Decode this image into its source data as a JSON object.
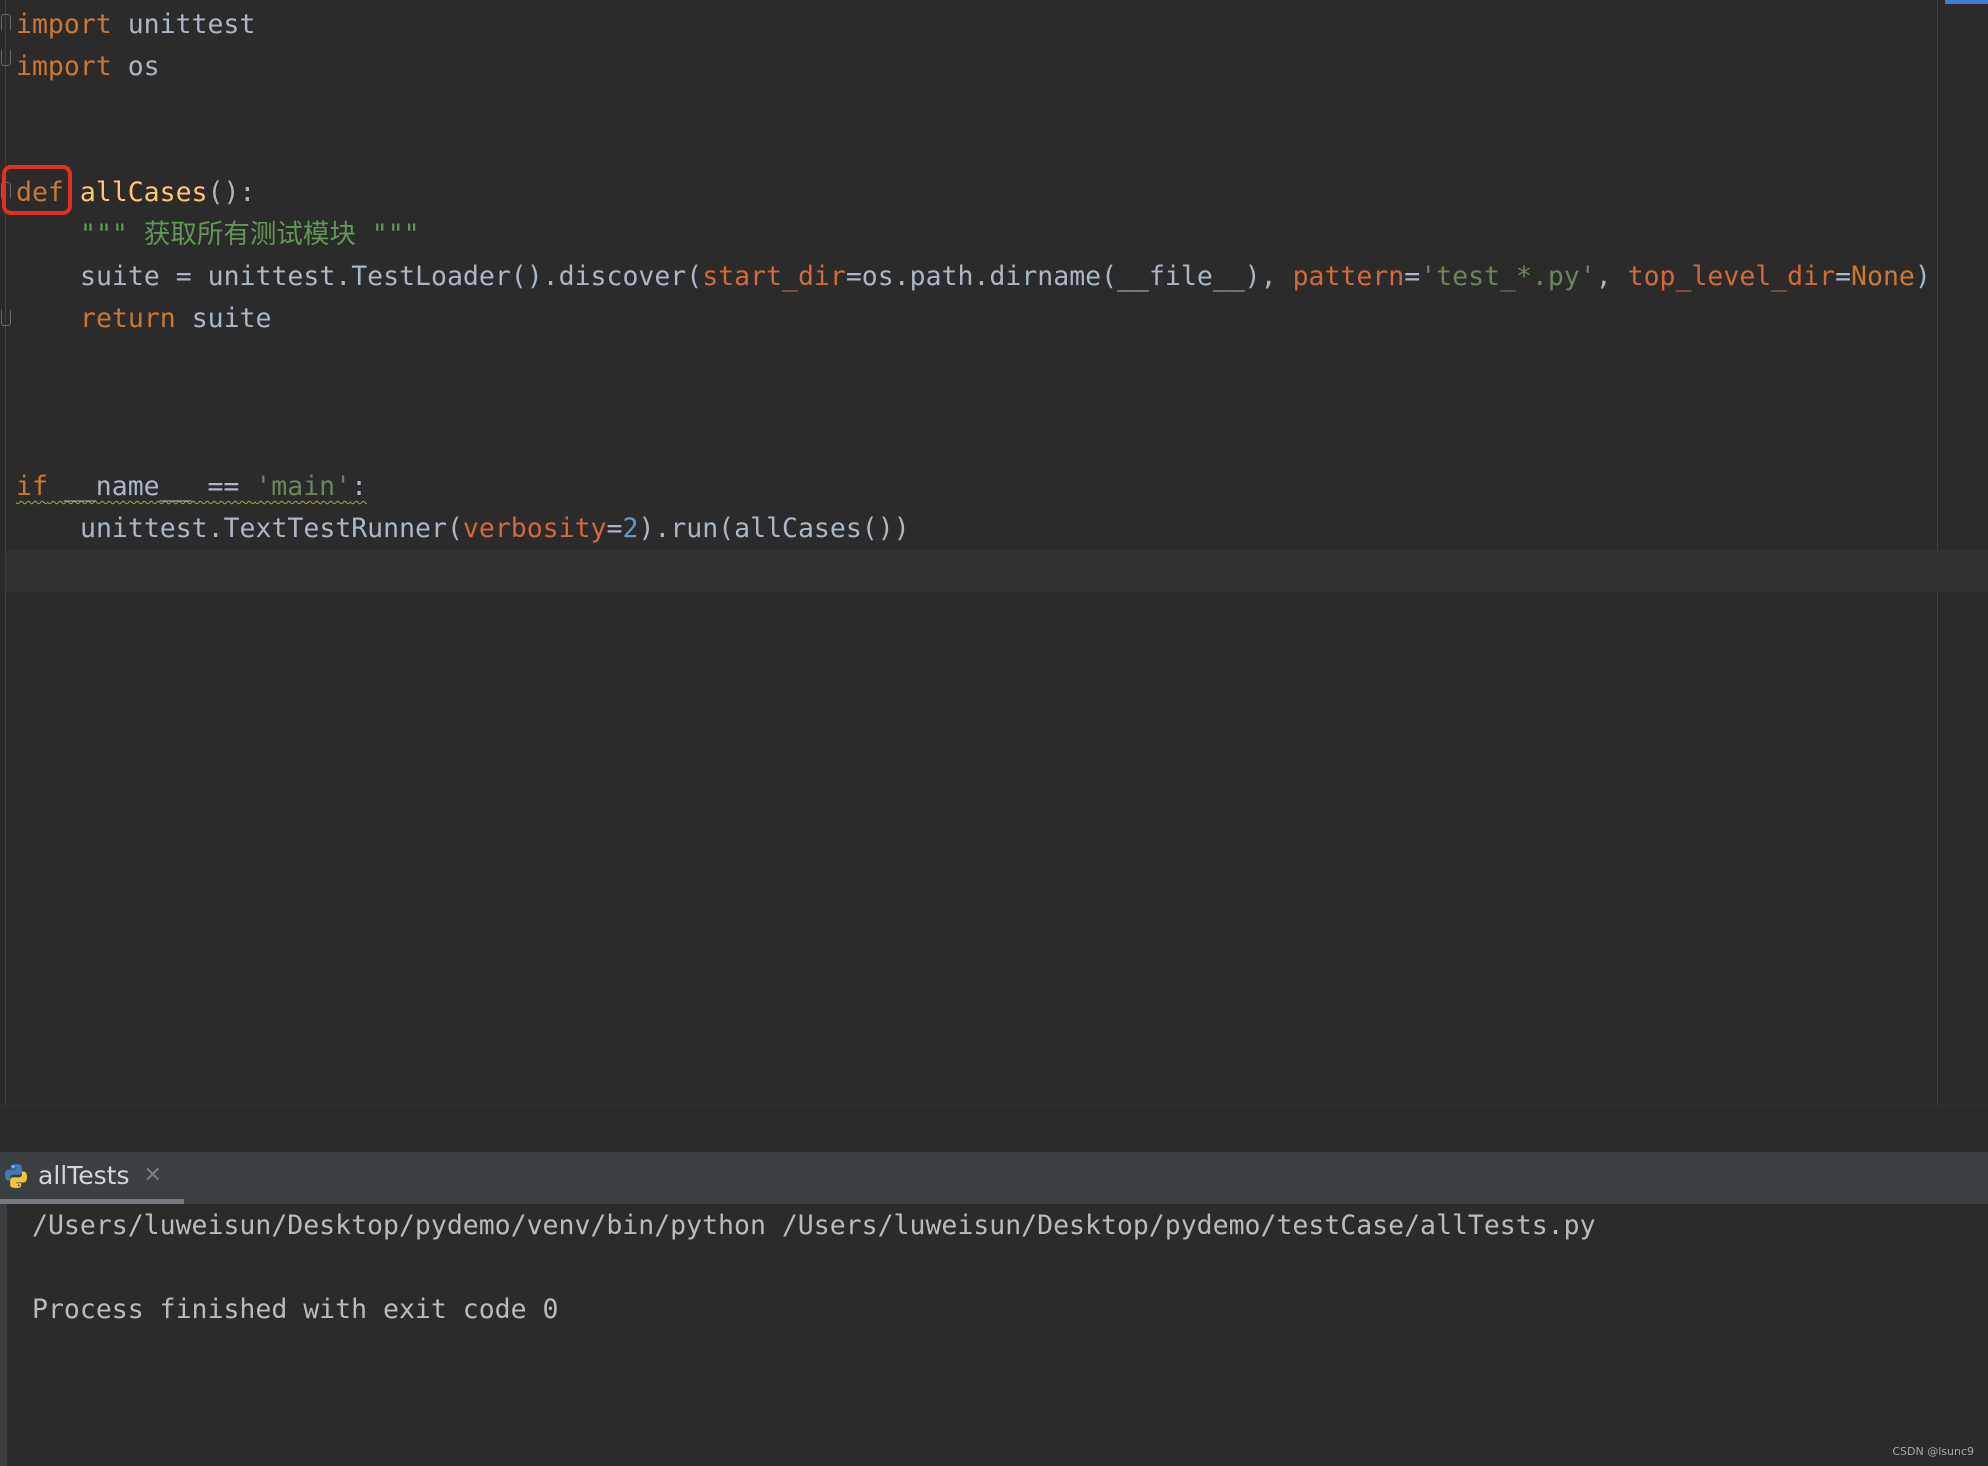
{
  "editor": {
    "lines": {
      "l1": {
        "kw": "import",
        "rest": " unittest"
      },
      "l2": {
        "kw": "import",
        "rest": " os"
      },
      "l5": {
        "kw": "def",
        "sp": " ",
        "fn": "allCases",
        "rest": "():"
      },
      "l6": {
        "doc": "\"\"\" 获取所有测试模块 \"\"\""
      },
      "l7": {
        "a": "suite = unittest.TestLoader().discover(",
        "p1": "start_dir",
        "b": "=os.path.dirname(__file__), ",
        "p2": "pattern",
        "c": "=",
        "s1": "'test_*.py'",
        "d": ", ",
        "p3": "top_level_dir",
        "e": "=",
        "k1": "None",
        "f": ")"
      },
      "l8": {
        "kw": "return",
        "rest": " suite"
      },
      "l12": {
        "kw": "if",
        "a": " __name__ == ",
        "s": "'main'",
        "b": ":"
      },
      "l13": {
        "a": "unittest.TextTestRunner(",
        "p": "verbosity",
        "b": "=",
        "n": "2",
        "c": ").run(allCases())"
      }
    }
  },
  "run_panel": {
    "tab_label": "allTests",
    "close_glyph": "✕",
    "console": {
      "command": "/Users/luweisun/Desktop/pydemo/venv/bin/python /Users/luweisun/Desktop/pydemo/testCase/allTests.py",
      "exit_message": "Process finished with exit code 0"
    }
  },
  "watermark": "CSDN @lsunc9",
  "colors": {
    "background": "#2b2b2b",
    "keyword": "#cc7832",
    "function": "#ffc66d",
    "parameter": "#d3693b",
    "string": "#6a8759",
    "number": "#6897bb",
    "docstring": "#629755",
    "highlight_box": "#e0321e"
  }
}
